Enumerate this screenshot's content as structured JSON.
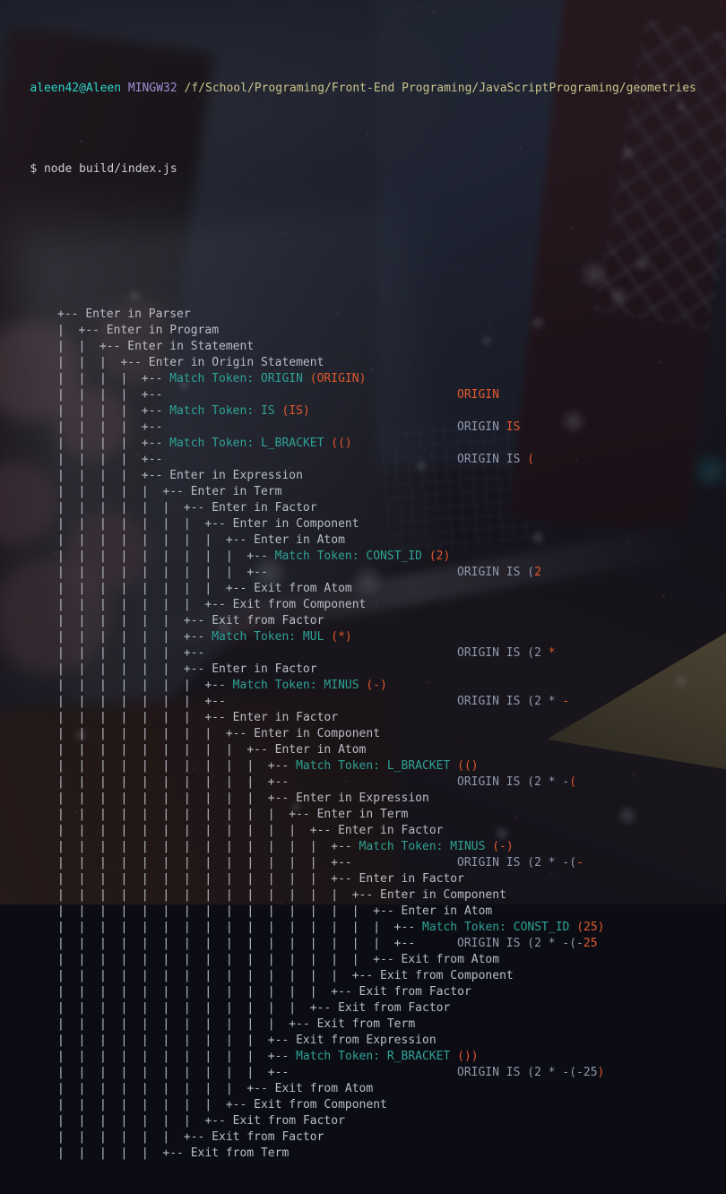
{
  "window": {
    "title": "MINGW32:/f/School/Programing/Front-End Programing/JavaScriptPrograming/geometries",
    "shell": "MINGW32"
  },
  "prompt": {
    "user_host": "aleen42@Aleen",
    "shell_tag": "MINGW32",
    "path": "/f/School/Programing/Front-End Programing/JavaScriptPrograming/geometries",
    "symbol": "$",
    "command": "node build/index.js"
  },
  "colors": {
    "user": "#2fd4c8",
    "host": "#9b8fd6",
    "path": "#c7c48a",
    "tree": "#b9bdc6",
    "match": "#2fa295",
    "token": "#e2582c",
    "consumed": "#8f99ad",
    "background": "#0e0f16"
  },
  "trace": [
    {
      "indent": "+-- ",
      "label": "Enter in Parser"
    },
    {
      "indent": "|  +-- ",
      "label": "Enter in Program"
    },
    {
      "indent": "|  |  +-- ",
      "label": "Enter in Statement"
    },
    {
      "indent": "|  |  |  +-- ",
      "label": "Enter in Origin Statement"
    },
    {
      "indent": "|  |  |  |  +-- ",
      "match": "Match Token: ORIGIN ",
      "token": "(ORIGIN)"
    },
    {
      "indent": "|  |  |  |  +--",
      "right_old": "",
      "right_new": "ORIGIN"
    },
    {
      "indent": "|  |  |  |  +-- ",
      "match": "Match Token: IS ",
      "token": "(IS)"
    },
    {
      "indent": "|  |  |  |  +--",
      "right_old": "ORIGIN ",
      "right_new": "IS"
    },
    {
      "indent": "|  |  |  |  +-- ",
      "match": "Match Token: L_BRACKET ",
      "token": "(()"
    },
    {
      "indent": "|  |  |  |  +--",
      "right_old": "ORIGIN IS ",
      "right_new": "("
    },
    {
      "indent": "|  |  |  |  +-- ",
      "label": "Enter in Expression"
    },
    {
      "indent": "|  |  |  |  |  +-- ",
      "label": "Enter in Term"
    },
    {
      "indent": "|  |  |  |  |  |  +-- ",
      "label": "Enter in Factor"
    },
    {
      "indent": "|  |  |  |  |  |  |  +-- ",
      "label": "Enter in Component"
    },
    {
      "indent": "|  |  |  |  |  |  |  |  +-- ",
      "label": "Enter in Atom"
    },
    {
      "indent": "|  |  |  |  |  |  |  |  |  +-- ",
      "match": "Match Token: CONST_ID ",
      "token": "(2)"
    },
    {
      "indent": "|  |  |  |  |  |  |  |  |  +--",
      "right_old": "ORIGIN IS (",
      "right_new": "2"
    },
    {
      "indent": "|  |  |  |  |  |  |  |  +-- ",
      "label": "Exit from Atom"
    },
    {
      "indent": "|  |  |  |  |  |  |  +-- ",
      "label": "Exit from Component"
    },
    {
      "indent": "|  |  |  |  |  |  +-- ",
      "label": "Exit from Factor"
    },
    {
      "indent": "|  |  |  |  |  |  +-- ",
      "match": "Match Token: MUL ",
      "token": "(*)"
    },
    {
      "indent": "|  |  |  |  |  |  +--",
      "right_old": "ORIGIN IS (2 ",
      "right_new": "*"
    },
    {
      "indent": "|  |  |  |  |  |  +-- ",
      "label": "Enter in Factor"
    },
    {
      "indent": "|  |  |  |  |  |  |  +-- ",
      "match": "Match Token: MINUS ",
      "token": "(-)"
    },
    {
      "indent": "|  |  |  |  |  |  |  +--",
      "right_old": "ORIGIN IS (2 * ",
      "right_new": "-"
    },
    {
      "indent": "|  |  |  |  |  |  |  +-- ",
      "label": "Enter in Factor"
    },
    {
      "indent": "|  |  |  |  |  |  |  |  +-- ",
      "label": "Enter in Component"
    },
    {
      "indent": "|  |  |  |  |  |  |  |  |  +-- ",
      "label": "Enter in Atom"
    },
    {
      "indent": "|  |  |  |  |  |  |  |  |  |  +-- ",
      "match": "Match Token: L_BRACKET ",
      "token": "(()"
    },
    {
      "indent": "|  |  |  |  |  |  |  |  |  |  +--",
      "right_old": "ORIGIN IS (2 * -",
      "right_new": "("
    },
    {
      "indent": "|  |  |  |  |  |  |  |  |  |  +-- ",
      "label": "Enter in Expression"
    },
    {
      "indent": "|  |  |  |  |  |  |  |  |  |  |  +-- ",
      "label": "Enter in Term"
    },
    {
      "indent": "|  |  |  |  |  |  |  |  |  |  |  |  +-- ",
      "label": "Enter in Factor"
    },
    {
      "indent": "|  |  |  |  |  |  |  |  |  |  |  |  |  +-- ",
      "match": "Match Token: MINUS ",
      "token": "(-)"
    },
    {
      "indent": "|  |  |  |  |  |  |  |  |  |  |  |  |  +--",
      "right_old": "ORIGIN IS (2 * -(",
      "right_new": "-"
    },
    {
      "indent": "|  |  |  |  |  |  |  |  |  |  |  |  |  +-- ",
      "label": "Enter in Factor"
    },
    {
      "indent": "|  |  |  |  |  |  |  |  |  |  |  |  |  |  +-- ",
      "label": "Enter in Component"
    },
    {
      "indent": "|  |  |  |  |  |  |  |  |  |  |  |  |  |  |  +-- ",
      "label": "Enter in Atom"
    },
    {
      "indent": "|  |  |  |  |  |  |  |  |  |  |  |  |  |  |  |  +-- ",
      "match": "Match Token: CONST_ID ",
      "token": "(25)"
    },
    {
      "indent": "|  |  |  |  |  |  |  |  |  |  |  |  |  |  |  |  +--",
      "right_old": "ORIGIN IS (2 * -(-",
      "right_new": "25"
    },
    {
      "indent": "|  |  |  |  |  |  |  |  |  |  |  |  |  |  |  +-- ",
      "label": "Exit from Atom"
    },
    {
      "indent": "|  |  |  |  |  |  |  |  |  |  |  |  |  |  +-- ",
      "label": "Exit from Component"
    },
    {
      "indent": "|  |  |  |  |  |  |  |  |  |  |  |  |  +-- ",
      "label": "Exit from Factor"
    },
    {
      "indent": "|  |  |  |  |  |  |  |  |  |  |  |  +-- ",
      "label": "Exit from Factor"
    },
    {
      "indent": "|  |  |  |  |  |  |  |  |  |  |  +-- ",
      "label": "Exit from Term"
    },
    {
      "indent": "|  |  |  |  |  |  |  |  |  |  +-- ",
      "label": "Exit from Expression"
    },
    {
      "indent": "|  |  |  |  |  |  |  |  |  |  +-- ",
      "match": "Match Token: R_BRACKET ",
      "token": "())"
    },
    {
      "indent": "|  |  |  |  |  |  |  |  |  |  +--",
      "right_old": "ORIGIN IS (2 * -(-25",
      "right_new": ")"
    },
    {
      "indent": "|  |  |  |  |  |  |  |  |  +-- ",
      "label": "Exit from Atom"
    },
    {
      "indent": "|  |  |  |  |  |  |  |  +-- ",
      "label": "Exit from Component"
    },
    {
      "indent": "|  |  |  |  |  |  |  +-- ",
      "label": "Exit from Factor"
    },
    {
      "indent": "|  |  |  |  |  |  +-- ",
      "label": "Exit from Factor"
    },
    {
      "indent": "|  |  |  |  |  +-- ",
      "label": "Exit from Term"
    }
  ]
}
